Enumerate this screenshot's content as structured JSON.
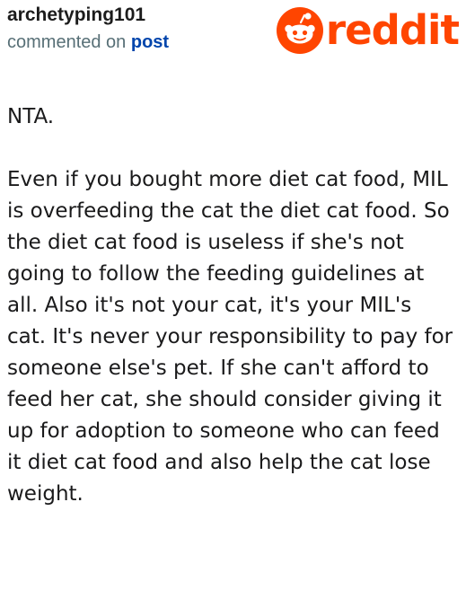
{
  "header": {
    "username": "archetyping101",
    "action_text": "commented on",
    "post_link_text": "post"
  },
  "brand": {
    "wordmark": "reddit",
    "icon": "reddit-alien-icon",
    "color": "#ff4500"
  },
  "comment": {
    "paragraphs": [
      "NTA.",
      "Even if you bought more diet cat food, MIL is overfeeding the cat the diet cat food. So the diet cat food is useless if she's not going to follow the feeding guidelines at all. Also it's not your cat, it's your MIL's cat. It's never your responsibility to pay for someone else's pet. If she can't afford to feed her cat, she should consider giving it up for adoption to someone who can feed it diet cat food and also help the cat lose weight."
    ]
  },
  "colors": {
    "text_primary": "#1a1a1b",
    "text_secondary": "#576f76",
    "link": "#0045ac"
  }
}
